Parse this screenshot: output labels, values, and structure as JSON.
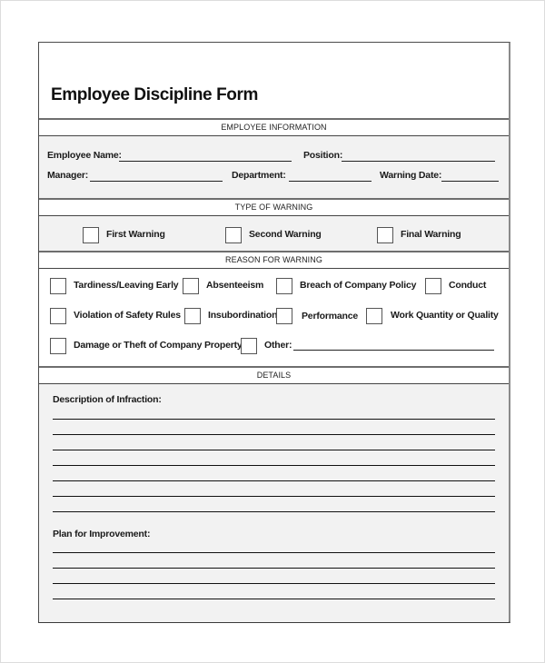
{
  "form": {
    "title": "Employee Discipline Form",
    "sections": {
      "employee_information": {
        "header": "EMPLOYEE INFORMATION",
        "fields": {
          "employee_name": {
            "label": "Employee Name:",
            "value": ""
          },
          "position": {
            "label": "Position:",
            "value": ""
          },
          "manager": {
            "label": "Manager:",
            "value": ""
          },
          "department": {
            "label": "Department:",
            "value": ""
          },
          "warning_date": {
            "label": "Warning Date:",
            "value": ""
          }
        }
      },
      "type_of_warning": {
        "header": "TYPE OF WARNING",
        "options": [
          {
            "label": "First Warning",
            "checked": false
          },
          {
            "label": "Second Warning",
            "checked": false
          },
          {
            "label": "Final Warning",
            "checked": false
          }
        ]
      },
      "reason_for_warning": {
        "header": "REASON FOR WARNING",
        "options": [
          {
            "label": "Tardiness/Leaving Early",
            "checked": false
          },
          {
            "label": "Absenteeism",
            "checked": false
          },
          {
            "label": "Breach of Company Policy",
            "checked": false
          },
          {
            "label": "Conduct",
            "checked": false
          },
          {
            "label": "Violation of Safety Rules",
            "checked": false
          },
          {
            "label": "Insubordination",
            "checked": false
          },
          {
            "label": "Performance",
            "checked": false
          },
          {
            "label": "Work Quantity or Quality",
            "checked": false
          },
          {
            "label": "Damage or Theft of Company Property",
            "checked": false
          },
          {
            "label": "Other:",
            "checked": false
          }
        ],
        "other_value": ""
      },
      "details": {
        "header": "DETAILS",
        "description_label": "Description of Infraction:",
        "description_line_count": 7,
        "plan_label": "Plan for Improvement:",
        "plan_line_count": 4
      }
    }
  }
}
